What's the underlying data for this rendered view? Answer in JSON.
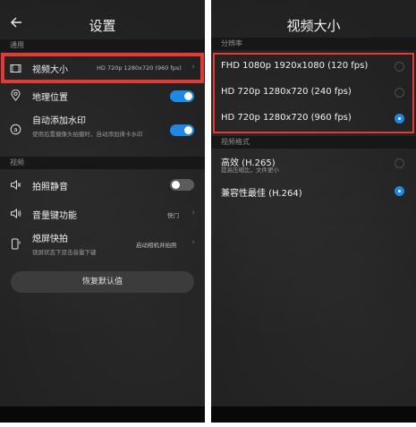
{
  "colors": {
    "accent": "#1e88e5",
    "highlight": "#e53935",
    "background": "#212121"
  },
  "left": {
    "title": "设置",
    "sections": {
      "general": "通用",
      "video": "视频"
    },
    "items": {
      "video_size": {
        "label": "视频大小",
        "value": "HD 720p  1280x720 (960 fps)",
        "icon": "film-icon"
      },
      "location": {
        "label": "地理位置",
        "icon": "location-icon",
        "enabled": true
      },
      "watermark": {
        "label": "自动添加水印",
        "sub": "使用后置摄像头拍摄时，自动添加徕卡水印",
        "icon": "watermark-icon",
        "enabled": true
      },
      "mute": {
        "label": "拍照静音",
        "icon": "mute-icon",
        "enabled": false
      },
      "volume_key": {
        "label": "音量键功能",
        "value": "快门",
        "icon": "volume-icon"
      },
      "snapshot": {
        "label": "熄屏快拍",
        "sub": "锁屏状态下双击音量下键",
        "value": "启动相机并拍照",
        "icon": "phone-icon"
      }
    },
    "restore_button": "恢复默认值"
  },
  "right": {
    "title": "视频大小",
    "sections": {
      "resolution": "分辨率",
      "format": "视频格式"
    },
    "resolution_options": [
      {
        "label": "FHD 1080p  1920x1080 (120 fps)",
        "selected": false
      },
      {
        "label": "HD 720p  1280x720 (240 fps)",
        "selected": false
      },
      {
        "label": "HD 720p  1280x720 (960 fps)",
        "selected": true
      }
    ],
    "format_options": [
      {
        "label": "高效 (H.265)",
        "sub": "提高压缩比，文件更小",
        "selected": false
      },
      {
        "label": "兼容性最佳 (H.264)",
        "selected": true
      }
    ]
  }
}
